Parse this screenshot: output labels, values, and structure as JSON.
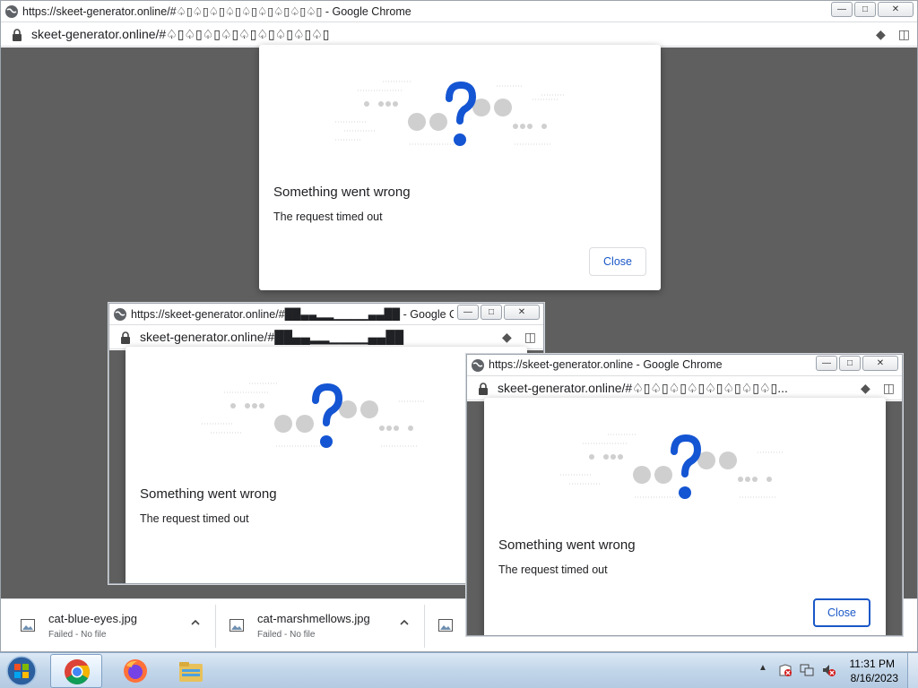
{
  "window_main": {
    "title": "https://skeet-generator.online/#♤▯♤▯♤▯♤▯♤▯♤▯♤▯♤▯♤▯ - Google Chrome",
    "url": "skeet-generator.online/#♤▯♤▯♤▯♤▯♤▯♤▯♤▯♤▯♤▯",
    "dialog": {
      "title": "Something went wrong",
      "message": "The request timed out",
      "close_label": "Close"
    }
  },
  "window_left": {
    "title": "https://skeet-generator.online/#██▄▄▂▂▁▁▁▁▄▄██ - Google Ch...",
    "url": "skeet-generator.online/#██▄▄▂▂▁▁▁▁▄▄██",
    "dialog": {
      "title": "Something went wrong",
      "message": "The request timed out"
    }
  },
  "window_right": {
    "title": "https://skeet-generator.online - Google Chrome",
    "url": "skeet-generator.online/#♤▯♤▯♤▯♤▯♤▯♤▯♤▯♤▯...",
    "dialog": {
      "title": "Something went wrong",
      "message": "The request timed out",
      "close_label": "Close"
    }
  },
  "downloads": [
    {
      "name": "cat-blue-eyes.jpg",
      "status": "Failed - No file"
    },
    {
      "name": "cat-marshmellows.jpg",
      "status": "Failed - No file"
    }
  ],
  "taskbar": {
    "apps": [
      "chrome-icon",
      "firefox-icon",
      "file-explorer-icon"
    ],
    "time": "11:31 PM",
    "date": "8/16/2023"
  },
  "colors": {
    "accent": "#1a57c8",
    "question": "#1455d3",
    "backdrop": "#5f5f5f"
  }
}
